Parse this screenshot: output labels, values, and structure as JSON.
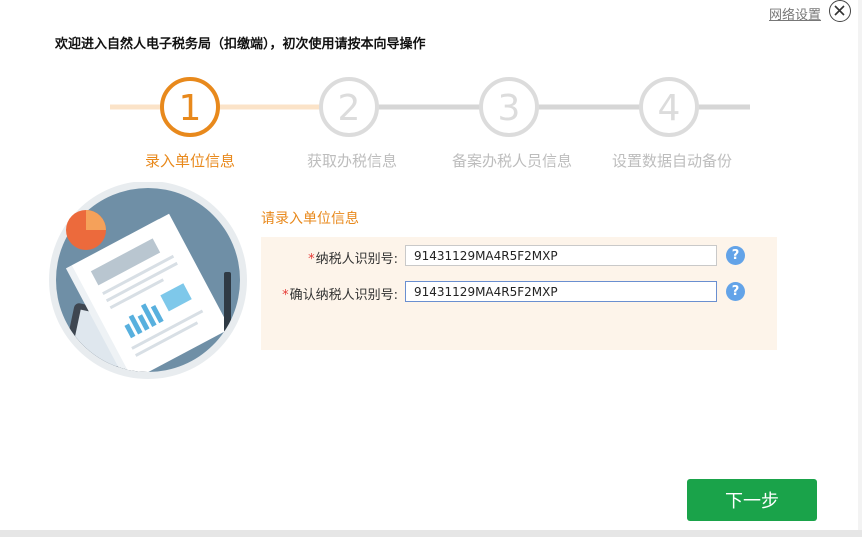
{
  "window": {
    "network_settings_label": "网络设置",
    "welcome_text": "欢迎进入自然人电子税务局（扣缴端），初次使用请按本向导操作"
  },
  "wizard": {
    "steps": [
      {
        "number": "1",
        "label": "录入单位信息",
        "state": "active"
      },
      {
        "number": "2",
        "label": "获取办税信息",
        "state": "inactive"
      },
      {
        "number": "3",
        "label": "备案办税人员信息",
        "state": "inactive"
      },
      {
        "number": "4",
        "label": "设置数据自动备份",
        "state": "inactive"
      }
    ],
    "current_step": 1,
    "colors": {
      "active": "#e8891c",
      "inactive": "#dcdcdc",
      "active_track": "#fbe3c8"
    }
  },
  "form": {
    "title": "请录入单位信息",
    "required_mark": "*",
    "fields": [
      {
        "label": "纳税人识别号:",
        "value": "91431129MA4R5F2MXP",
        "help": "?"
      },
      {
        "label": "确认纳税人识别号:",
        "value": "91431129MA4R5F2MXP",
        "help": "?"
      }
    ]
  },
  "actions": {
    "next_label": "下一步",
    "next_color": "#1aa34a"
  },
  "icons": [
    "close-icon",
    "help-icon",
    "document-illustration"
  ]
}
